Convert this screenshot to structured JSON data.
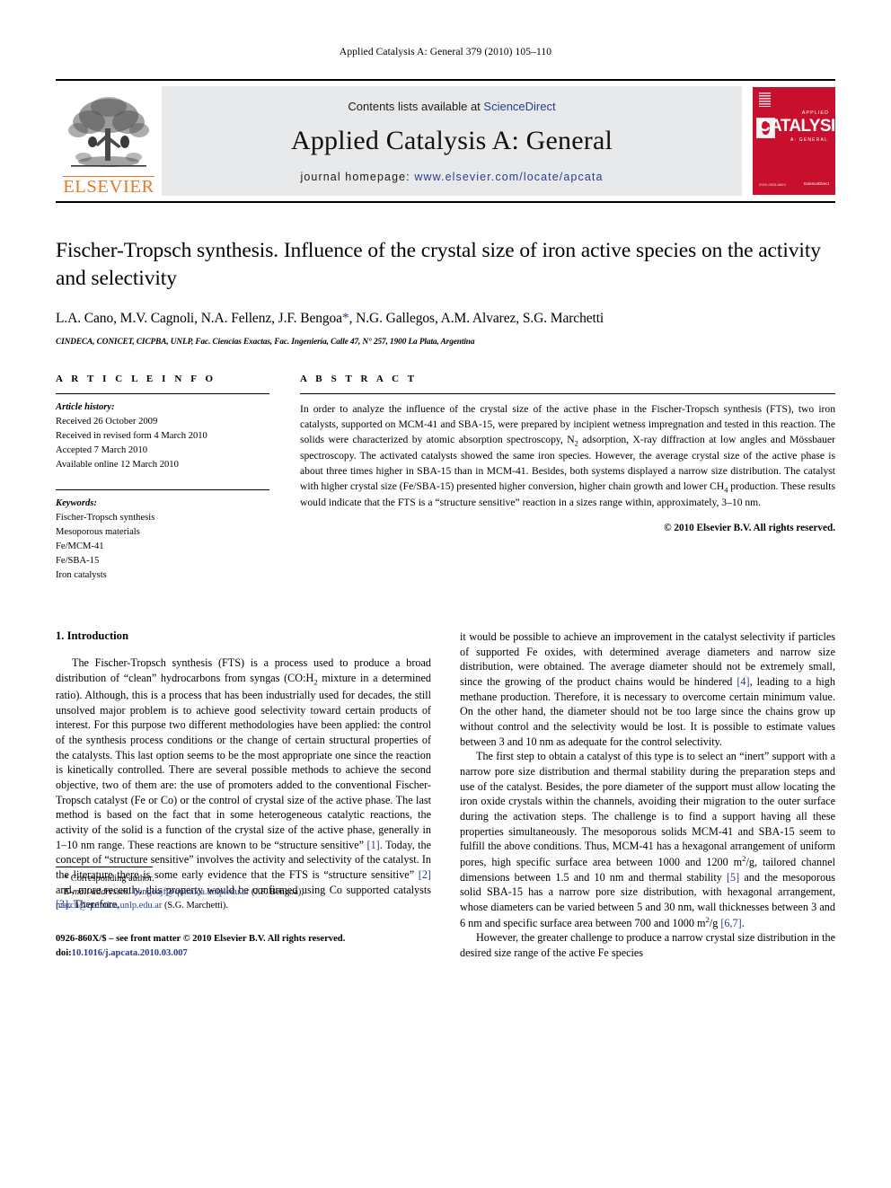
{
  "running_head": "Applied Catalysis A: General 379 (2010) 105–110",
  "masthead": {
    "contents_prefix": "Contents lists available at ",
    "sciencedirect": "ScienceDirect",
    "journal_title": "Applied Catalysis A: General",
    "homepage_prefix": "journal homepage: ",
    "homepage_url": "www.elsevier.com/locate/apcata",
    "publisher": "ELSEVIER",
    "cover": {
      "applied": "APPLIED",
      "main": "CATALYSIS",
      "sub": "A: GENERAL",
      "bottom": "Available online at\nScienceDirect",
      "corner": "ISSN 0926-860X"
    },
    "link_color": "#2b3c8f",
    "brand_orange": "#E87722",
    "cover_red": "#c8102e"
  },
  "article": {
    "title": "Fischer-Tropsch synthesis. Influence of the crystal size of iron active species on the activity and selectivity",
    "authors_before_star": "L.A. Cano, M.V. Cagnoli, N.A. Fellenz, J.F. Bengoa",
    "corresponding_marker": "*",
    "authors_after_star": ", N.G. Gallegos, A.M. Alvarez, S.G. Marchetti",
    "affiliation": "CINDECA, CONICET, CICPBA, UNLP, Fac. Ciencias Exactas, Fac. Ingeniería, Calle 47, N° 257, 1900 La Plata, Argentina"
  },
  "article_info": {
    "heading": "A R T I C L E   I N F O",
    "history_label": "Article history:",
    "history": [
      "Received 26 October 2009",
      "Received in revised form 4 March 2010",
      "Accepted 7 March 2010",
      "Available online 12 March 2010"
    ],
    "keywords_label": "Keywords:",
    "keywords": [
      "Fischer-Tropsch synthesis",
      "Mesoporous materials",
      "Fe/MCM-41",
      "Fe/SBA-15",
      "Iron catalysts"
    ]
  },
  "abstract": {
    "heading": "A B S T R A C T",
    "part1": "In order to analyze the influence of the crystal size of the active phase in the Fischer-Tropsch synthesis (FTS), two iron catalysts, supported on MCM-41 and SBA-15, were prepared by incipient wetness impregnation and tested in this reaction. The solids were characterized by atomic absorption spectroscopy, N",
    "sub1": "2",
    "part2": " adsorption, X-ray diffraction at low angles and Mössbauer spectroscopy. The activated catalysts showed the same iron species. However, the average crystal size of the active phase is about three times higher in SBA-15 than in MCM-41. Besides, both systems displayed a narrow size distribution. The catalyst with higher crystal size (Fe/SBA-15) presented higher conversion, higher chain growth and lower CH",
    "sub2": "4",
    "part3": " production. These results would indicate that the FTS is a “structure sensitive” reaction in a sizes range within, approximately, 3–10 nm.",
    "copyright": "© 2010 Elsevier B.V. All rights reserved."
  },
  "introduction": {
    "heading": "1.  Introduction",
    "p1_a": "The Fischer-Tropsch synthesis (FTS) is a process used to produce a broad distribution of “clean” hydrocarbons from syngas (CO:H",
    "p1_sub": "2",
    "p1_b": " mixture in a determined ratio). Although, this is a process that has been industrially used for decades, the still unsolved major problem is to achieve good selectivity toward certain products of interest. For this purpose two different methodologies have been applied: the control of the synthesis process conditions or the change of certain structural properties of the catalysts. This last option seems to be the most appropriate one since the reaction is kinetically controlled. There are several possible methods to achieve the second objective, two of them are: the use of promoters added to the conventional Fischer-Tropsch catalyst (Fe or Co) or the control of crystal size of the active phase. The last method is based on the fact that in some heterogeneous catalytic reactions, the activity of the solid is a function of the crystal size of the active phase, generally in 1–10 nm range. These reactions are known to be “structure sensitive” ",
    "cite1": "[1]",
    "p1_c": ". Today, the concept of “structure sensitive” involves the activity and selectivity of the catalyst. In the literature there is some early evidence that the FTS is “structure sensitive” ",
    "cite2": "[2]",
    "p1_d": " and, more recently, this property would be confirmed using Co supported catalysts ",
    "cite3": "[3]",
    "p1_e": ". Therefore,",
    "p2_a": "it would be possible to achieve an improvement in the catalyst selectivity if particles of supported Fe oxides, with determined average diameters and narrow size distribution, were obtained. The average diameter should not be extremely small, since the growing of the product chains would be hindered ",
    "cite4": "[4]",
    "p2_b": ", leading to a high methane production. Therefore, it is necessary to overcome certain minimum value. On the other hand, the diameter should not be too large since the chains grow up without control and the selectivity would be lost. It is possible to estimate values between 3 and 10 nm as adequate for the control selectivity.",
    "p3_a": "The first step to obtain a catalyst of this type is to select an “inert” support with a narrow pore size distribution and thermal stability during the preparation steps and use of the catalyst. Besides, the pore diameter of the support must allow locating the iron oxide crystals within the channels, avoiding their migration to the outer surface during the activation steps. The challenge is to find a support having all these properties simultaneously. The mesoporous solids MCM-41 and SBA-15 seem to fulfill the above conditions. Thus, MCM-41 has a hexagonal arrangement of uniform pores, high specific surface area between 1000 and 1200 m",
    "p3_sup1": "2",
    "p3_b": "/g, tailored channel dimensions between 1.5 and 10 nm and thermal stability ",
    "cite5": "[5]",
    "p3_c": " and the mesoporous solid SBA-15 has a narrow pore size distribution, with hexagonal arrangement, whose diameters can be varied between 5 and 30 nm, wall thicknesses between 3 and 6 nm and specific surface area between 700 and 1000 m",
    "p3_sup2": "2",
    "p3_d": "/g ",
    "cite67": "[6,7]",
    "p3_e": ".",
    "p4": "However, the greater challenge to produce a narrow crystal size distribution in the desired size range of the active Fe species"
  },
  "footnotes": {
    "corresponding": "* Corresponding author.",
    "email_label": "E-mail addresses:",
    "email1": "bengoajf@quimica.unlp.edu.ar",
    "email1_who": " (J.F. Bengoa),",
    "email2": "march@quimica.unlp.edu.ar",
    "email2_who": " (S.G. Marchetti).",
    "imprint": "0926-860X/$ – see front matter © 2010 Elsevier B.V. All rights reserved.",
    "doi_label": "doi:",
    "doi": "10.1016/j.apcata.2010.03.007"
  }
}
